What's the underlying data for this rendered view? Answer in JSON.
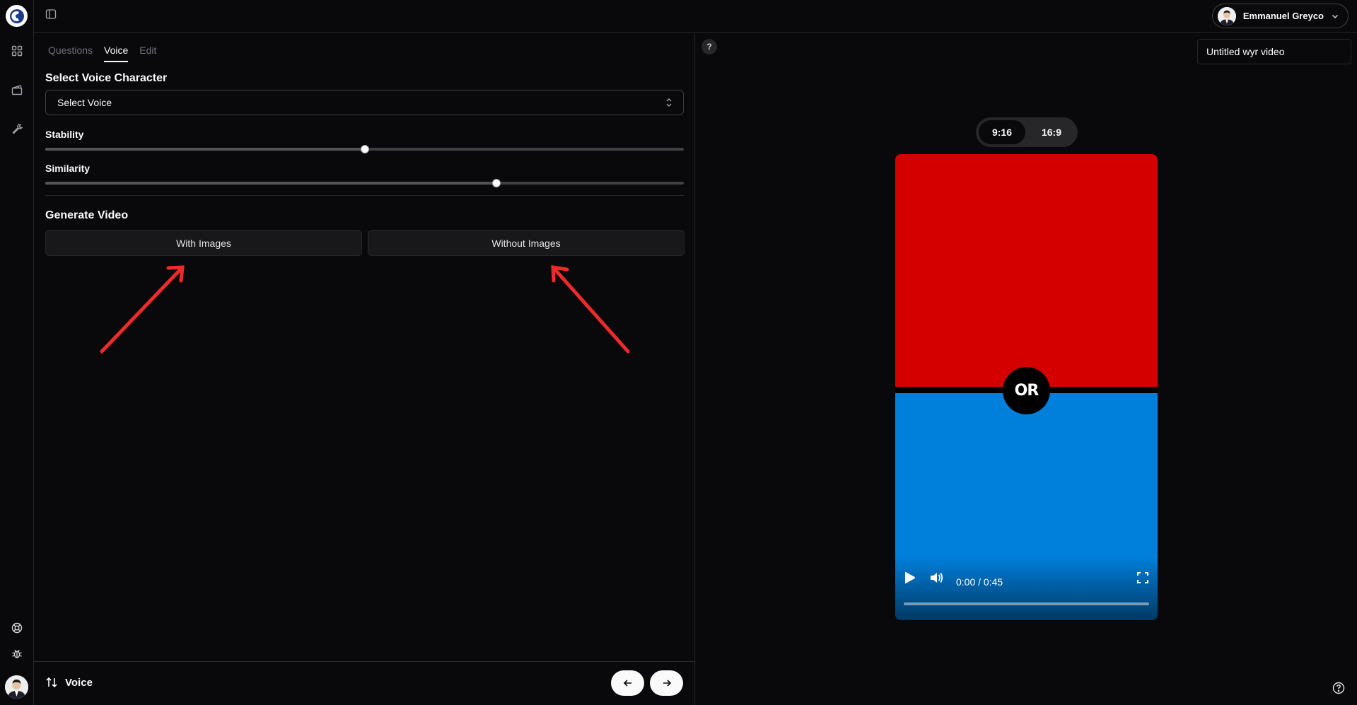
{
  "header": {
    "user_name": "Emmanuel Greyco"
  },
  "tabs": [
    {
      "label": "Questions",
      "active": false
    },
    {
      "label": "Voice",
      "active": true
    },
    {
      "label": "Edit",
      "active": false
    }
  ],
  "voice": {
    "section_title": "Select Voice Character",
    "select_value": "Select Voice",
    "stability_label": "Stability",
    "stability_value": 0.5,
    "similarity_label": "Similarity",
    "similarity_value": 0.707
  },
  "generate": {
    "section_title": "Generate Video",
    "with_images_label": "With Images",
    "without_images_label": "Without Images"
  },
  "footer": {
    "step_label": "Voice"
  },
  "preview": {
    "help_label": "?",
    "title_value": "Untitled wyr video",
    "ratios": [
      {
        "label": "9:16",
        "active": true
      },
      {
        "label": "16:9",
        "active": false
      }
    ],
    "or_label": "OR",
    "time_label": "0:00 / 0:45",
    "top_color": "#d40000",
    "bottom_color": "#007fdb"
  },
  "colors": {
    "annotation_arrow": "#ee2b2b",
    "background": "#09090b"
  }
}
